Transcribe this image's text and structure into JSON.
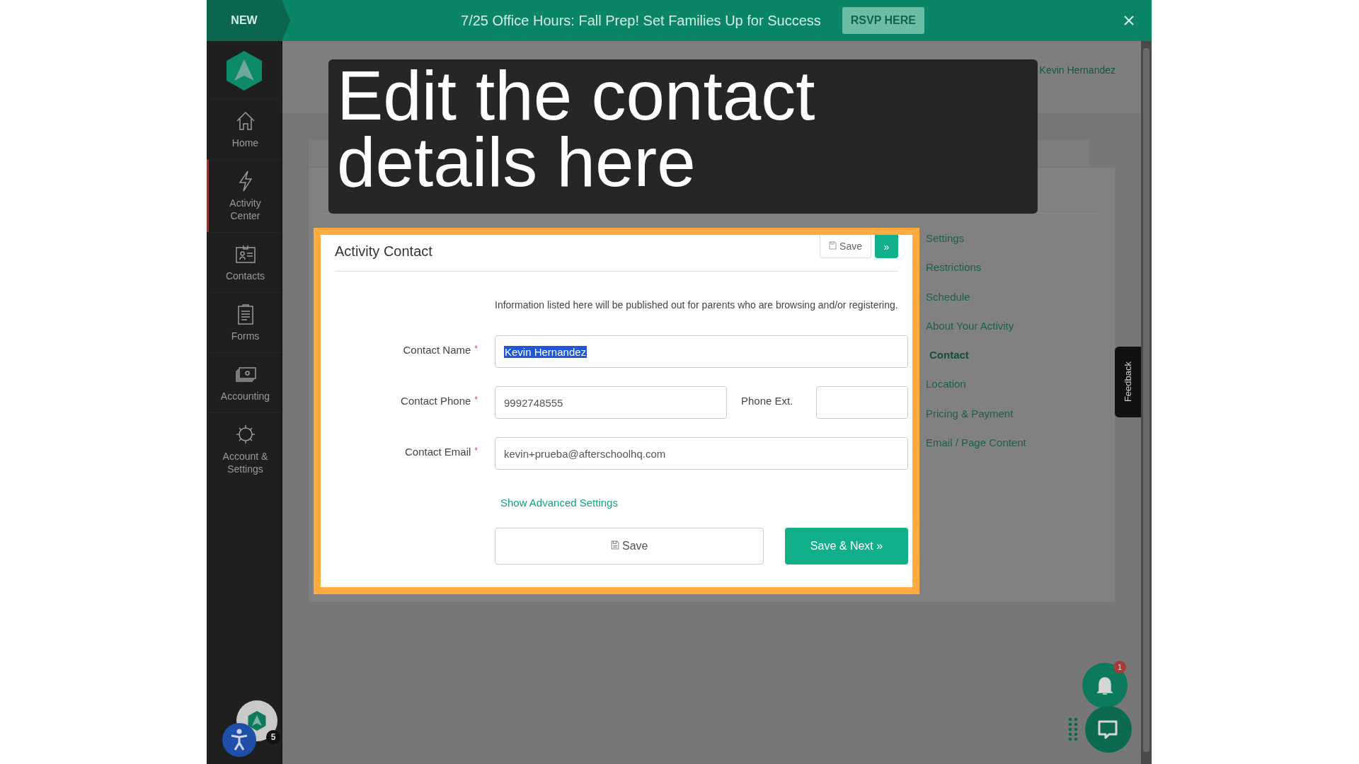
{
  "banner": {
    "tag": "NEW",
    "message": "7/25 Office Hours: Fall Prep! Set Families Up for Success",
    "button": "RSVP HERE"
  },
  "sidebar": {
    "items": [
      {
        "label": "Home",
        "kind": "home",
        "selected": false
      },
      {
        "label": "Activity Center",
        "kind": "bolt",
        "selected": true
      },
      {
        "label": "Contacts",
        "kind": "card",
        "selected": false
      },
      {
        "label": "Forms",
        "kind": "clipboard",
        "selected": false
      },
      {
        "label": "Accounting",
        "kind": "money",
        "selected": false
      },
      {
        "label": "Account & Settings",
        "kind": "gear",
        "selected": false
      }
    ],
    "accessibility_badge": "5"
  },
  "header": {
    "user": "Kevin Hernandez"
  },
  "caption": "Edit the contact details here",
  "panel": {
    "title": "Activity Contact",
    "top_save": "Save",
    "top_next": "»",
    "intro": "Information listed here will be published out for parents who are browsing and/or registering.",
    "required_mark": "*",
    "fields": [
      {
        "label": "Contact Name",
        "required": true,
        "value": "Kevin Hernandez",
        "highlighted": true
      },
      {
        "label": "Contact Phone",
        "required": true,
        "value": "9992748555",
        "highlighted": false,
        "extension_label": "Phone Ext."
      },
      {
        "label": "Contact Email",
        "required": true,
        "value": "kevin+prueba@afterschoolhq.com",
        "highlighted": false
      }
    ],
    "advanced_link": "Show Advanced Settings",
    "save": "Save",
    "save_next": "Save & Next »"
  },
  "nav": [
    {
      "label": "Settings",
      "selected": false
    },
    {
      "label": "Restrictions",
      "selected": false
    },
    {
      "label": "Schedule",
      "selected": false
    },
    {
      "label": "About Your Activity",
      "selected": false
    },
    {
      "label": "Contact",
      "selected": true
    },
    {
      "label": "Location",
      "selected": false
    },
    {
      "label": "Pricing & Payment",
      "selected": false
    },
    {
      "label": "Email / Page Content",
      "selected": false
    }
  ],
  "feedback": "Feedback",
  "notifications": {
    "count": "1"
  }
}
